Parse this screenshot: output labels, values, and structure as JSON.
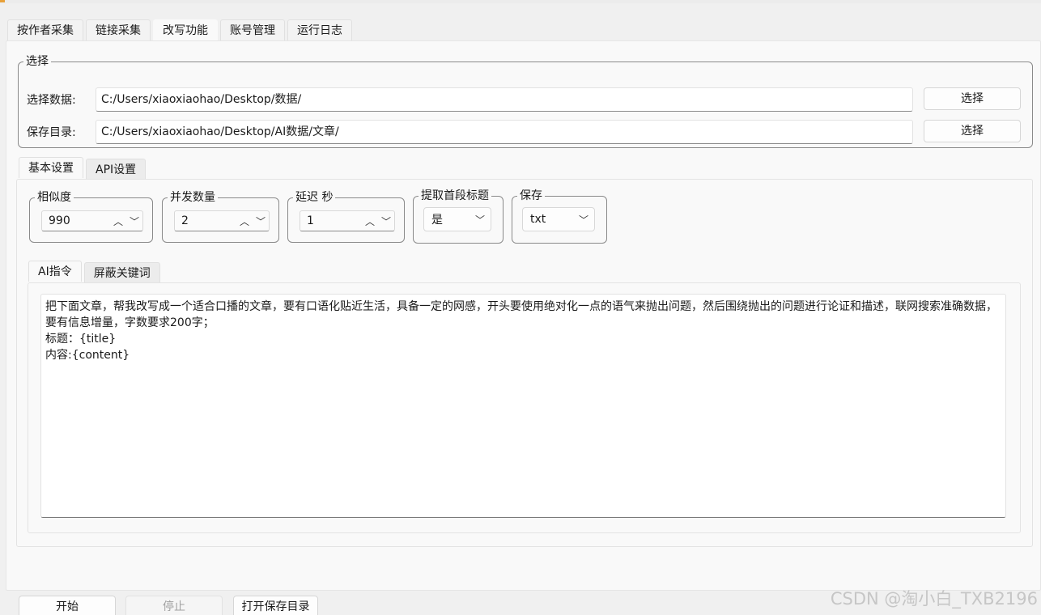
{
  "main_tabs": [
    "按作者采集",
    "链接采集",
    "改写功能",
    "账号管理",
    "运行日志"
  ],
  "select_group": {
    "title": "选择",
    "data_label": "选择数据:",
    "data_path": "C:/Users/xiaoxiaohao/Desktop/数据/",
    "data_button": "选择",
    "save_label": "保存目录:",
    "save_path": "C:/Users/xiaoxiaohao/Desktop/AI数据/文章/",
    "save_button": "选择"
  },
  "settings_tabs": [
    "基本设置",
    "API设置"
  ],
  "settings": {
    "similarity": {
      "label": "相似度",
      "value": "990"
    },
    "concurrency": {
      "label": "并发数量",
      "value": "2"
    },
    "delay": {
      "label": "延迟 秒",
      "value": "1"
    },
    "extract_title": {
      "label": "提取首段标题",
      "value": "是"
    },
    "save_format": {
      "label": "保存",
      "value": "txt"
    }
  },
  "ai_tabs": [
    "AI指令",
    "屏蔽关键词"
  ],
  "prompt_text": "把下面文章，帮我改写成一个适合口播的文章，要有口语化贴近生活，具备一定的网感，开头要使用绝对化一点的语气来抛出问题，然后围绕抛出的问题进行论证和描述，联网搜索准确数据，要有信息增量，字数要求200字；\n标题：{title}\n内容:{content}",
  "buttons": {
    "start": "开始",
    "stop": "停止",
    "open_dir": "打开保存目录"
  },
  "watermark": "CSDN @淘小白_TXB2196"
}
